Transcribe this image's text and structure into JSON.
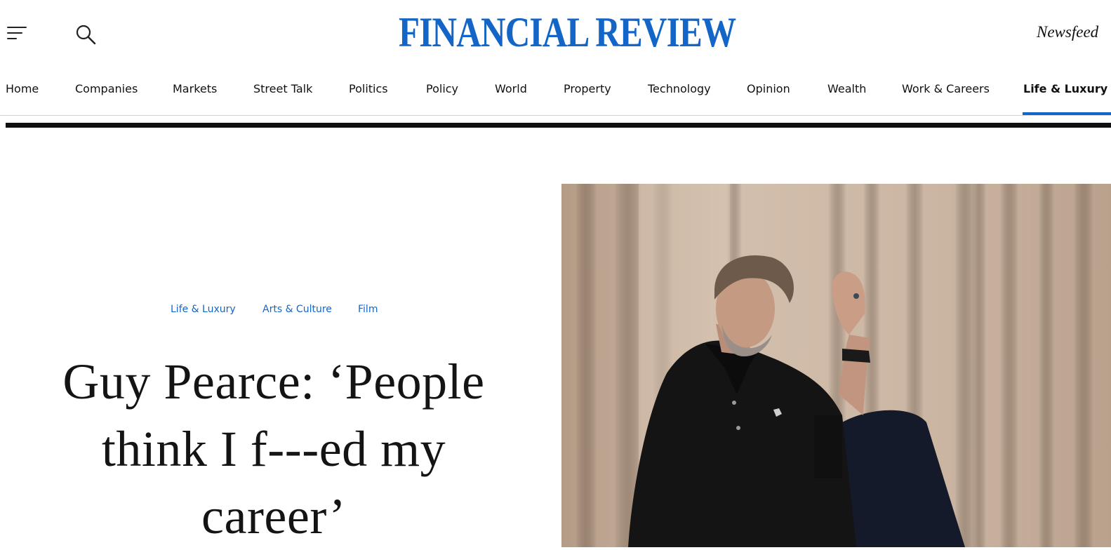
{
  "header": {
    "logo_text": "FINANCIAL REVIEW",
    "newsfeed_label": "Newsfeed",
    "menu_icon": "hamburger-menu-icon",
    "search_icon": "search-icon",
    "brand_color": "#1366c8"
  },
  "nav": {
    "items": [
      {
        "label": "Home"
      },
      {
        "label": "Companies"
      },
      {
        "label": "Markets"
      },
      {
        "label": "Street Talk"
      },
      {
        "label": "Politics"
      },
      {
        "label": "Policy"
      },
      {
        "label": "World"
      },
      {
        "label": "Property"
      },
      {
        "label": "Technology"
      },
      {
        "label": "Opinion"
      },
      {
        "label": "Wealth"
      },
      {
        "label": "Work & Careers"
      },
      {
        "label": "Life & Luxury"
      }
    ],
    "active": "Life & Luxury"
  },
  "article": {
    "tags": [
      "Life & Luxury",
      "Arts & Culture",
      "Film"
    ],
    "headline_lines": [
      "Guy Pearce: ‘People",
      "think I f---ed my",
      "career’"
    ]
  }
}
